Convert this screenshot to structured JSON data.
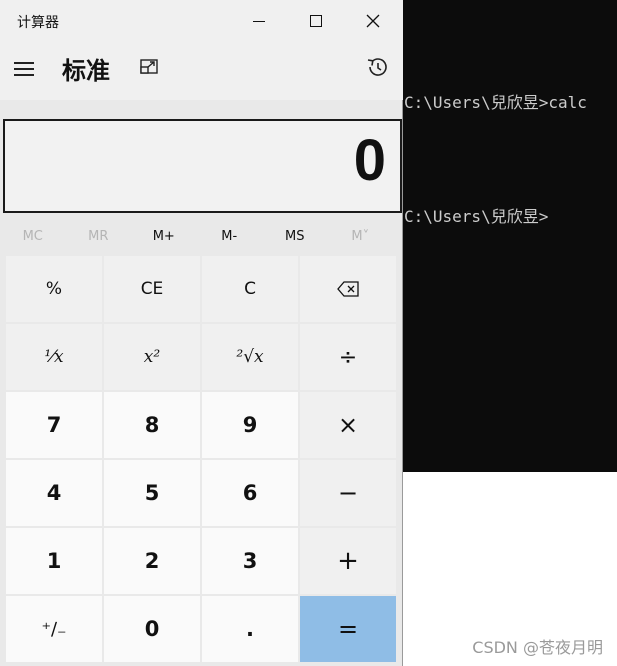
{
  "calculator": {
    "app_title": "计算器",
    "mode_title": "标准",
    "display_value": "0",
    "memory_buttons": [
      {
        "label": "MC",
        "enabled": false
      },
      {
        "label": "MR",
        "enabled": false
      },
      {
        "label": "M+",
        "enabled": true
      },
      {
        "label": "M-",
        "enabled": true
      },
      {
        "label": "MS",
        "enabled": true
      },
      {
        "label": "M˅",
        "enabled": false
      }
    ],
    "keys": {
      "percent": "%",
      "ce": "CE",
      "c": "C",
      "reciprocal": "⅟x",
      "square": "x²",
      "sqrt": "²√x",
      "divide": "÷",
      "seven": "7",
      "eight": "8",
      "nine": "9",
      "multiply": "×",
      "four": "4",
      "five": "5",
      "six": "6",
      "minus": "−",
      "one": "1",
      "two": "2",
      "three": "3",
      "plus": "+",
      "negate": "⁺∕₋",
      "zero": "0",
      "decimal": ".",
      "equals": "="
    },
    "equals_color": "#8fbde6"
  },
  "terminal": {
    "lines": [
      "C:\\Users\\兒欣昱>calc",
      "C:\\Users\\兒欣昱>"
    ]
  },
  "watermark": "CSDN @苍夜月明"
}
